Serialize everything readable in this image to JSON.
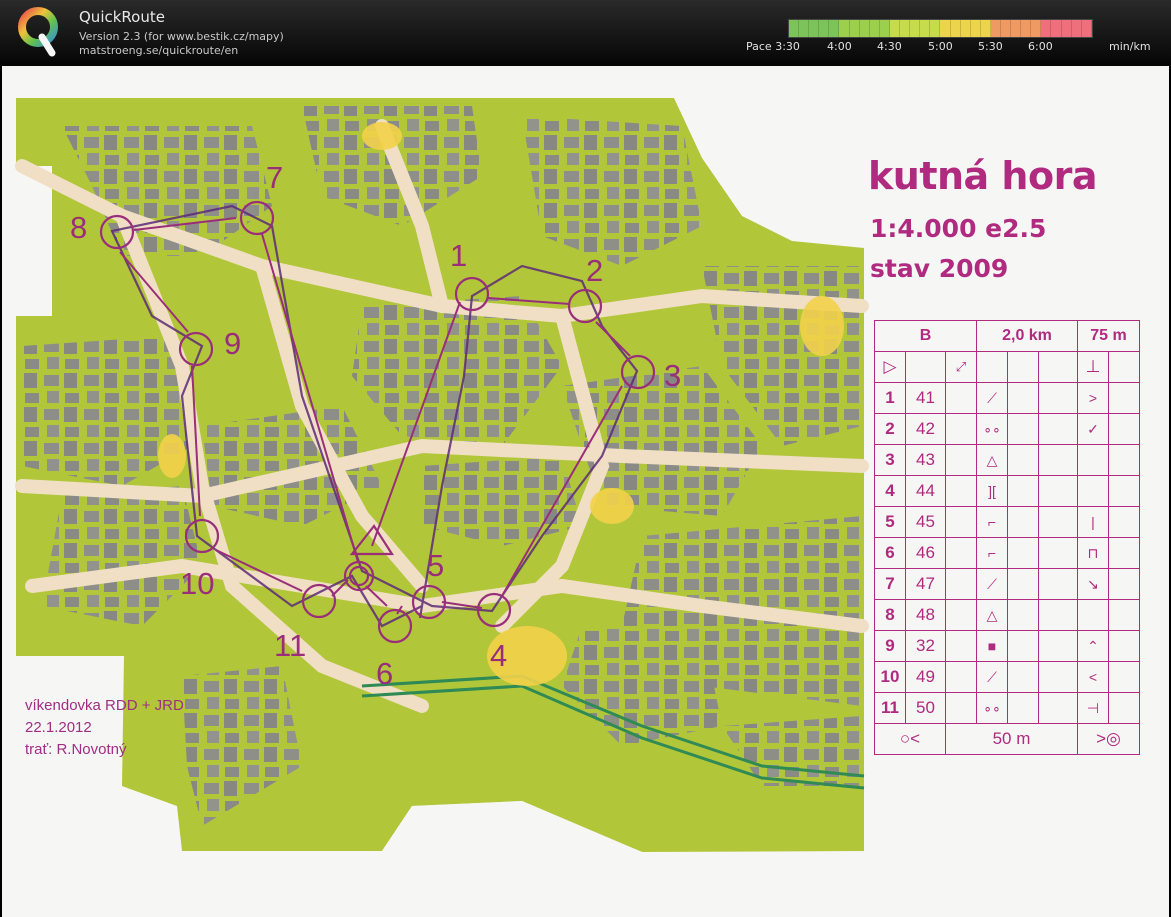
{
  "app": {
    "name": "QuickRoute",
    "version": "Version 2.3  (for www.bestik.cz/mapy)",
    "url": "matstroeng.se/quickroute/en"
  },
  "pace_scale": {
    "label": "Pace",
    "ticks": [
      "3:30",
      "4:00",
      "4:30",
      "5:00",
      "5:30",
      "6:00"
    ],
    "unit": "min/km",
    "colors": [
      "#7cc35a",
      "#9ccf4c",
      "#c6dc4a",
      "#ecd44c",
      "#ef9a62",
      "#ef6f7c"
    ]
  },
  "map": {
    "title": "kutná hora",
    "scale": "1:4.000  e2.5",
    "state": "stav 2009",
    "notes": [
      "víkendovka RDD + JRD",
      "22.1.2012",
      "trať: R.Novotný"
    ],
    "control_numbers": [
      "1",
      "2",
      "3",
      "4",
      "5",
      "6",
      "7",
      "8",
      "9",
      "10",
      "11"
    ],
    "course_color": "#9a2e7a",
    "route_color": "#5c2a78"
  },
  "description": {
    "course": "B",
    "length": "2,0 km",
    "climb": "75 m",
    "controls": [
      {
        "n": "1",
        "code": "41"
      },
      {
        "n": "2",
        "code": "42"
      },
      {
        "n": "3",
        "code": "43"
      },
      {
        "n": "4",
        "code": "44"
      },
      {
        "n": "5",
        "code": "45"
      },
      {
        "n": "6",
        "code": "46"
      },
      {
        "n": "7",
        "code": "47"
      },
      {
        "n": "8",
        "code": "48"
      },
      {
        "n": "9",
        "code": "32"
      },
      {
        "n": "10",
        "code": "49"
      },
      {
        "n": "11",
        "code": "50"
      }
    ],
    "finish_distance": "50 m"
  }
}
